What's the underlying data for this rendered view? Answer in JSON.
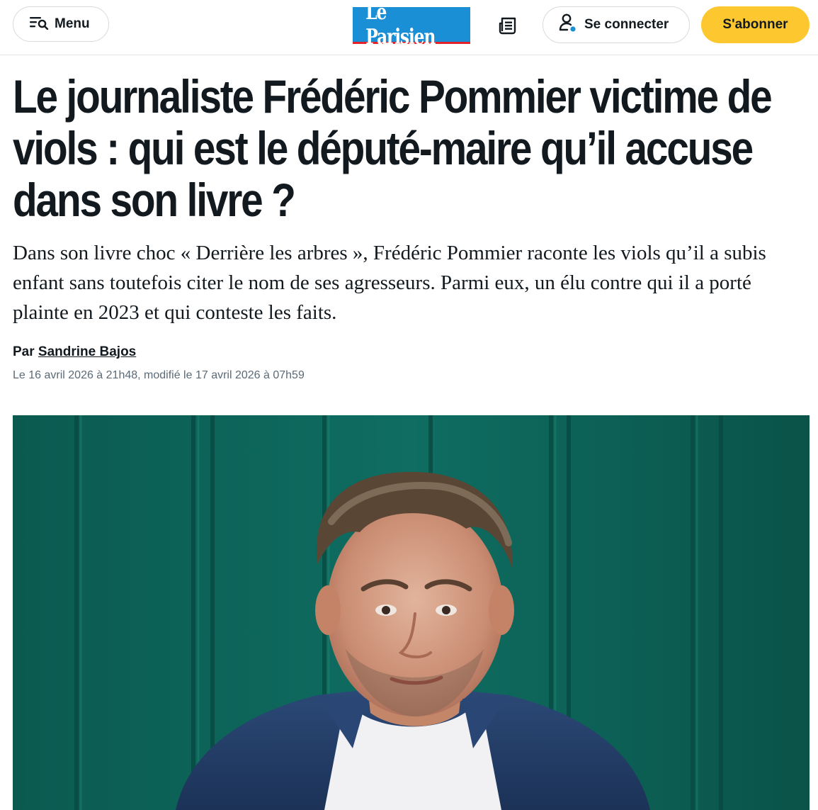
{
  "header": {
    "menu_label": "Menu",
    "logo_text": "Le Parisien",
    "login_label": "Se connecter",
    "subscribe_label": "S'abonner",
    "colors": {
      "logo_bg": "#1a8fd6",
      "logo_underline": "#e2232b",
      "subscribe_bg": "#fdc82f",
      "notification_dot": "#1a8fd6"
    },
    "icons": [
      "menu-search-icon",
      "newspaper-icon",
      "user-icon"
    ]
  },
  "article": {
    "title": "Le journaliste Frédéric Pommier victime de viols : qui est le député-maire qu’il accuse dans son livre ?",
    "lede": "Dans son livre choc « Derrière les arbres », Frédéric Pommier raconte les viols qu’il a subis enfant sans toutefois citer le nom de ses agresseurs. Parmi eux, un élu contre qui il a porté plainte en 2023 et qui conteste les faits.",
    "byline_prefix": "Par",
    "author": "Sandrine Bajos",
    "dateline": "Le 16 avril 2026 à 21h48, modifié le 17 avril 2026 à 07h59"
  }
}
